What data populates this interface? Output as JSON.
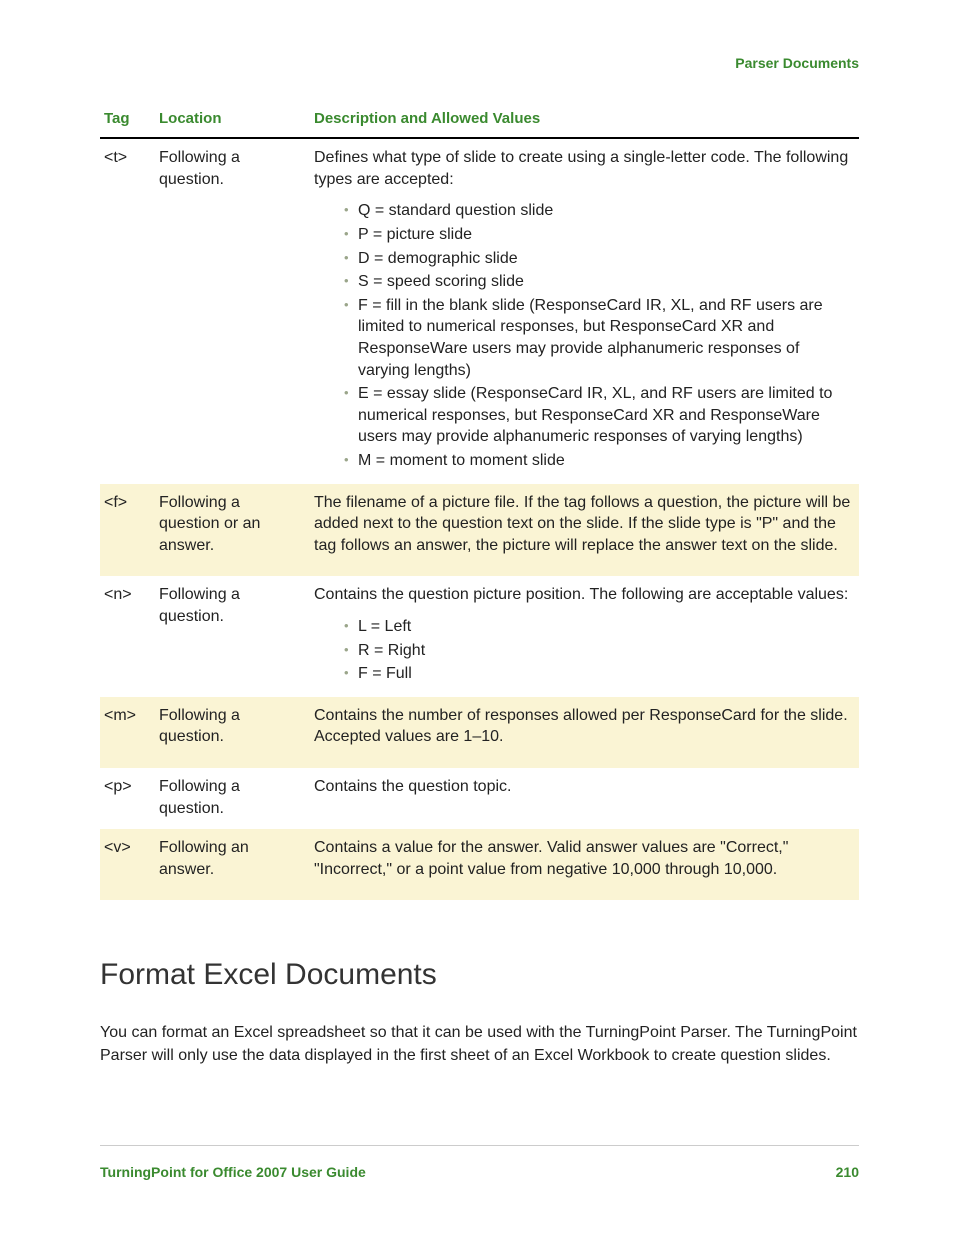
{
  "running_head": "Parser Documents",
  "table": {
    "headers": {
      "tag": "Tag",
      "location": "Location",
      "desc": "Description and Allowed Values"
    },
    "rows": [
      {
        "tag": "<t>",
        "location": "Following a question.",
        "intro": "Defines what type of slide to create using a single-letter code. The following types are accepted:",
        "bullets": [
          "Q = standard question slide",
          "P = picture slide",
          "D = demographic slide",
          "S = speed scoring slide",
          "F = fill in the blank slide (ResponseCard IR, XL, and RF users are limited to numerical responses, but ResponseCard XR and ResponseWare users may provide alphanumeric responses of varying lengths)",
          "E = essay slide (ResponseCard IR, XL, and RF users are limited to numerical responses, but ResponseCard XR and ResponseWare users may provide alphanumeric responses of varying lengths)",
          "M = moment to moment slide"
        ]
      },
      {
        "tag": "<f>",
        "location": "Following a question or an answer.",
        "intro": "The filename of a picture file. If the tag follows a question, the picture will be added next to the question text on the slide. If the slide type is \"P\" and the tag follows an answer, the picture will replace the answer text on the slide.",
        "bullets": []
      },
      {
        "tag": "<n>",
        "location": "Following a question.",
        "intro": "Contains the question picture position. The following are acceptable values:",
        "bullets": [
          "L = Left",
          "R = Right",
          "F = Full"
        ]
      },
      {
        "tag": "<m>",
        "location": "Following a question.",
        "intro": "Contains the number of responses allowed per ResponseCard for the slide. Accepted values are 1–10.",
        "bullets": []
      },
      {
        "tag": "<p>",
        "location": "Following a question.",
        "intro": "Contains the question topic.",
        "bullets": []
      },
      {
        "tag": "<v>",
        "location": "Following an answer.",
        "intro": "Contains a value for the answer. Valid answer values are \"Correct,\" \"Incorrect,\" or a point value from negative 10,000 through 10,000.",
        "bullets": []
      }
    ]
  },
  "section_heading": "Format Excel Documents",
  "section_body": "You can format an Excel spreadsheet so that it can be used with the TurningPoint Parser. The TurningPoint Parser will only use the data displayed in the first sheet of an Excel Workbook to create question slides.",
  "footer": {
    "left": "TurningPoint for Office 2007 User Guide",
    "right": "210"
  }
}
